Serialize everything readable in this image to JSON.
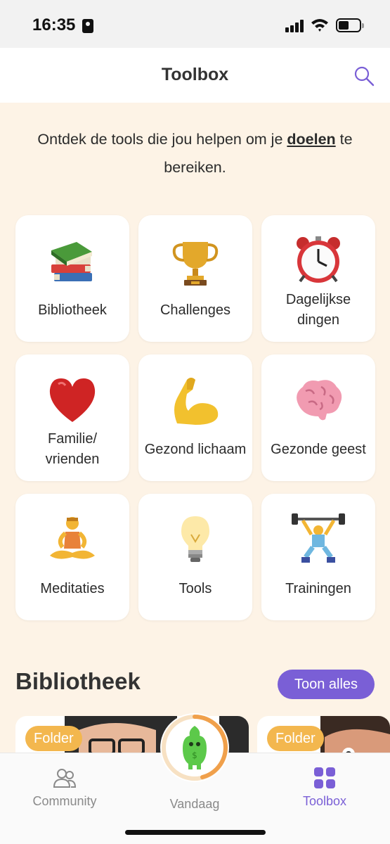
{
  "status_bar": {
    "time": "16:35"
  },
  "header": {
    "title": "Toolbox"
  },
  "intro": {
    "before": "Ontdek de tools die jou helpen om je ",
    "goal": "doelen",
    "after": " te bereiken."
  },
  "tiles": [
    {
      "label": "Bibliotheek",
      "icon": "books-icon"
    },
    {
      "label": "Challenges",
      "icon": "trophy-icon"
    },
    {
      "label": "Dagelijkse\ndingen",
      "icon": "alarm-clock-icon"
    },
    {
      "label": "Familie/\nvrienden",
      "icon": "heart-icon"
    },
    {
      "label": "Gezond lichaam",
      "icon": "flexed-biceps-icon"
    },
    {
      "label": "Gezonde geest",
      "icon": "brain-icon"
    },
    {
      "label": "Meditaties",
      "icon": "meditation-icon"
    },
    {
      "label": "Tools",
      "icon": "light-bulb-icon"
    },
    {
      "label": "Trainingen",
      "icon": "weightlifter-icon"
    }
  ],
  "library": {
    "title": "Bibliotheek",
    "show_all": "Toon alles",
    "cards": [
      {
        "badge": "Folder"
      },
      {
        "badge": "Folder"
      }
    ]
  },
  "tabbar": {
    "community": "Community",
    "today": "Vandaag",
    "toolbox": "Toolbox"
  },
  "colors": {
    "accent": "#7a5fd6",
    "background": "#fdf3e6",
    "badge": "#f3b74e",
    "progress": "#f0a04b"
  }
}
